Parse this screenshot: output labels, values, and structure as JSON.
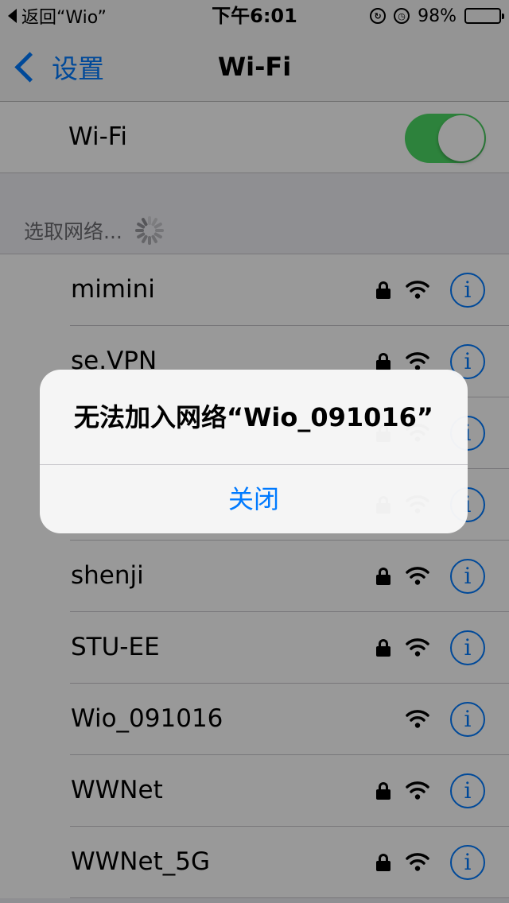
{
  "status_bar": {
    "back_label": "返回“Wio”",
    "time": "下午6:01",
    "battery_percent": "98%",
    "battery_level": 0.98,
    "rotation_lock_icon": "rotation-lock-icon",
    "alarm_icon": "alarm-icon"
  },
  "nav": {
    "back_label": "设置",
    "title": "Wi-Fi"
  },
  "wifi_toggle": {
    "label": "Wi-Fi",
    "state": "on",
    "color": "#4cd964"
  },
  "section": {
    "header": "选取网络..."
  },
  "networks": [
    {
      "name": "mimini",
      "locked": true
    },
    {
      "name": "se.VPN",
      "locked": true
    },
    {
      "name": "",
      "locked": true
    },
    {
      "name": "",
      "locked": true
    },
    {
      "name": "shenji",
      "locked": true
    },
    {
      "name": "STU-EE",
      "locked": true
    },
    {
      "name": "Wio_091016",
      "locked": false
    },
    {
      "name": "WWNet",
      "locked": true
    },
    {
      "name": "WWNet_5G",
      "locked": true
    }
  ],
  "alert": {
    "title": "无法加入网络“Wio_091016”",
    "close_label": "关闭"
  },
  "colors": {
    "accent": "#007aff",
    "toggle_on": "#4cd964",
    "background": "#efeff4"
  }
}
